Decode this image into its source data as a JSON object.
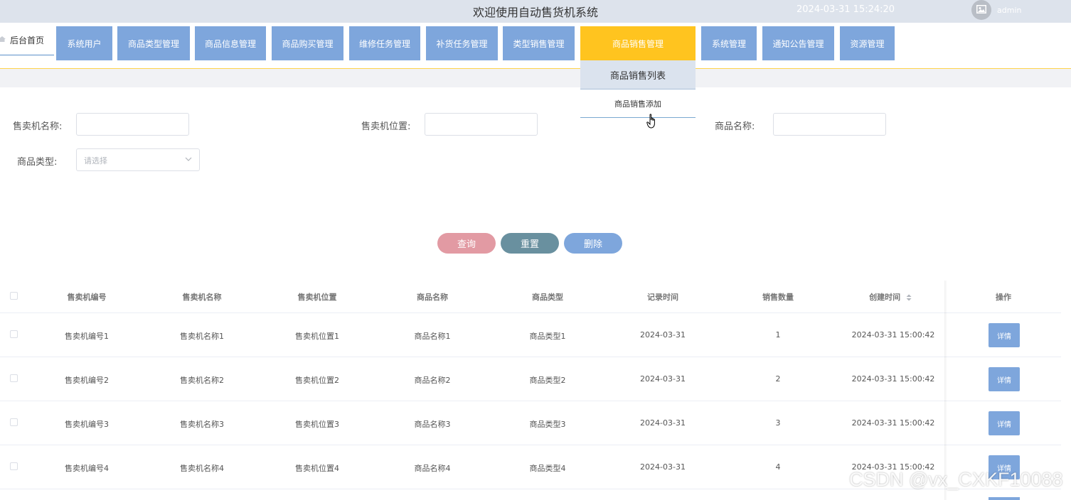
{
  "header": {
    "title": "欢迎使用自动售货机系统",
    "datetime": "2024-03-31 15:24:20",
    "username": "admin"
  },
  "nav": {
    "home_label": "后台首页",
    "items": [
      {
        "label": "系统用户"
      },
      {
        "label": "商品类型管理"
      },
      {
        "label": "商品信息管理"
      },
      {
        "label": "商品购买管理"
      },
      {
        "label": "维修任务管理"
      },
      {
        "label": "补货任务管理"
      },
      {
        "label": "类型销售管理"
      },
      {
        "label": "商品销售管理"
      },
      {
        "label": "系统管理"
      },
      {
        "label": "通知公告管理"
      },
      {
        "label": "资源管理"
      }
    ],
    "active": "商品销售管理",
    "dropdown": [
      "商品销售列表",
      "商品销售添加"
    ]
  },
  "search": {
    "machine_name_label": "售卖机名称:",
    "machine_location_label": "售卖机位置:",
    "product_name_label": "商品名称:",
    "product_type_label": "商品类型:",
    "product_type_placeholder": "请选择"
  },
  "actions": {
    "query": "查询",
    "reset": "重置",
    "delete": "删除"
  },
  "table": {
    "headers": [
      "售卖机编号",
      "售卖机名称",
      "售卖机位置",
      "商品名称",
      "商品类型",
      "记录时间",
      "销售数量",
      "创建时间",
      "操作"
    ],
    "detail_label": "详情",
    "rows": [
      {
        "no": "售卖机编号1",
        "name": "售卖机名称1",
        "location": "售卖机位置1",
        "product": "商品名称1",
        "type": "商品类型1",
        "date": "2024-03-31",
        "qty": "1",
        "created": "2024-03-31 15:00:42"
      },
      {
        "no": "售卖机编号2",
        "name": "售卖机名称2",
        "location": "售卖机位置2",
        "product": "商品名称2",
        "type": "商品类型2",
        "date": "2024-03-31",
        "qty": "2",
        "created": "2024-03-31 15:00:42"
      },
      {
        "no": "售卖机编号3",
        "name": "售卖机名称3",
        "location": "售卖机位置3",
        "product": "商品名称3",
        "type": "商品类型3",
        "date": "2024-03-31",
        "qty": "3",
        "created": "2024-03-31 15:00:42"
      },
      {
        "no": "售卖机编号4",
        "name": "售卖机名称4",
        "location": "售卖机位置4",
        "product": "商品名称4",
        "type": "商品类型4",
        "date": "2024-03-31",
        "qty": "4",
        "created": "2024-03-31 15:00:42"
      }
    ]
  },
  "watermark": "CSDN @vx_CXKF10088",
  "colors": {
    "nav_item": "#7ea6dc",
    "nav_active": "#ffc41f",
    "query": "#e29aa3",
    "reset": "#69909f",
    "delete": "#7ea6dc"
  }
}
